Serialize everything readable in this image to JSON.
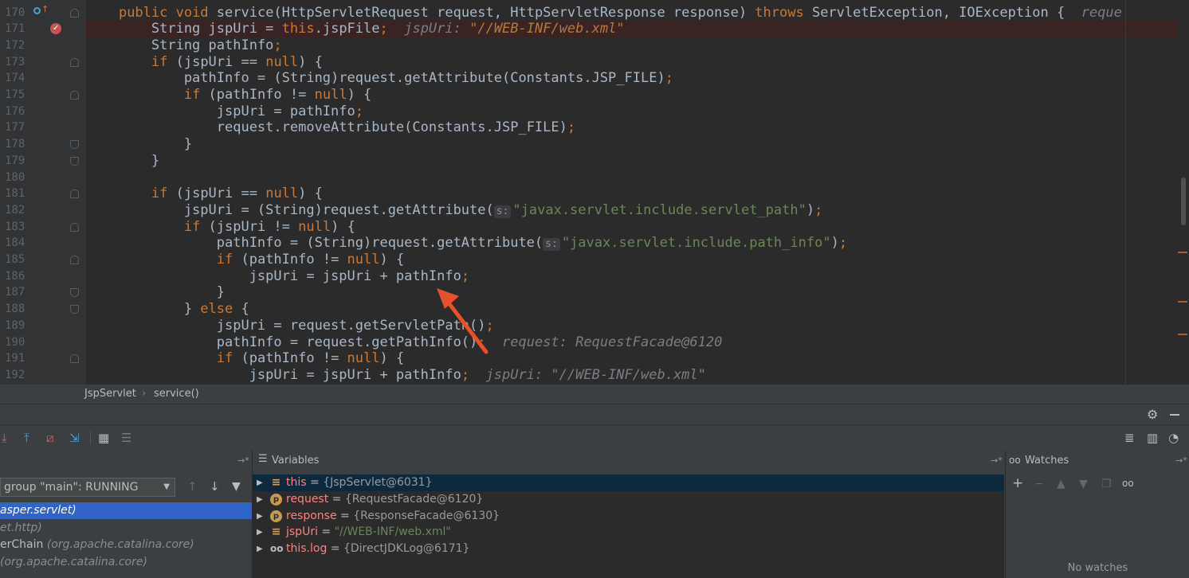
{
  "editor": {
    "lines": [
      {
        "n": "170",
        "html_key": "l170"
      },
      {
        "n": "171",
        "html_key": "l171"
      },
      {
        "n": "172",
        "html_key": "l172"
      },
      {
        "n": "173",
        "html_key": "l173"
      },
      {
        "n": "174",
        "html_key": "l174"
      },
      {
        "n": "175",
        "html_key": "l175"
      },
      {
        "n": "176",
        "html_key": "l176"
      },
      {
        "n": "177",
        "html_key": "l177"
      },
      {
        "n": "178",
        "html_key": "l178"
      },
      {
        "n": "179",
        "html_key": "l179"
      },
      {
        "n": "180",
        "html_key": "l180"
      },
      {
        "n": "181",
        "html_key": "l181"
      },
      {
        "n": "182",
        "html_key": "l182"
      },
      {
        "n": "183",
        "html_key": "l183"
      },
      {
        "n": "184",
        "html_key": "l184"
      },
      {
        "n": "185",
        "html_key": "l185"
      },
      {
        "n": "186",
        "html_key": "l186"
      },
      {
        "n": "187",
        "html_key": "l187"
      },
      {
        "n": "188",
        "html_key": "l188"
      },
      {
        "n": "189",
        "html_key": "l189"
      },
      {
        "n": "190",
        "html_key": "l190"
      },
      {
        "n": "191",
        "html_key": "l191"
      },
      {
        "n": "192",
        "html_key": "l192"
      }
    ],
    "code": {
      "l170": [
        [
          "    ",
          ""
        ],
        [
          "public void ",
          "kw"
        ],
        [
          "service(HttpServletRequest request, HttpServletResponse response) ",
          ""
        ],
        [
          "throws ",
          "kw"
        ],
        [
          "ServletException, IOException {  ",
          ""
        ],
        [
          "reque",
          "inlay"
        ]
      ],
      "l171": [
        [
          "        String ",
          ""
        ],
        [
          "jspUri = ",
          ""
        ],
        [
          "this",
          "kw"
        ],
        [
          ".jspFile",
          ""
        ],
        [
          ";",
          "kw"
        ],
        [
          "  jspUri: ",
          "inlay"
        ],
        [
          "\"//WEB-INF/web.xml\"",
          "inlay-str"
        ]
      ],
      "l172": [
        [
          "        String pathInfo",
          ""
        ],
        [
          ";",
          "kw"
        ]
      ],
      "l173": [
        [
          "        ",
          ""
        ],
        [
          "if ",
          "kw"
        ],
        [
          "(jspUri == ",
          ""
        ],
        [
          "null",
          "kw"
        ],
        [
          ") {",
          ""
        ]
      ],
      "l174": [
        [
          "            pathInfo = (String)request.getAttribute(Constants.",
          ""
        ],
        [
          "JSP_FILE",
          ""
        ],
        [
          ")",
          ""
        ],
        [
          ";",
          "kw"
        ]
      ],
      "l175": [
        [
          "            ",
          ""
        ],
        [
          "if ",
          "kw"
        ],
        [
          "(pathInfo != ",
          ""
        ],
        [
          "null",
          "kw"
        ],
        [
          ") {",
          ""
        ]
      ],
      "l176": [
        [
          "                jspUri = pathInfo",
          ""
        ],
        [
          ";",
          "kw"
        ]
      ],
      "l177": [
        [
          "                request.removeAttribute(Constants.",
          ""
        ],
        [
          "JSP_FILE",
          ""
        ],
        [
          ")",
          ""
        ],
        [
          ";",
          "kw"
        ]
      ],
      "l178": [
        [
          "            }",
          ""
        ]
      ],
      "l179": [
        [
          "        }",
          ""
        ]
      ],
      "l180": [
        [
          "",
          ""
        ]
      ],
      "l181": [
        [
          "        ",
          ""
        ],
        [
          "if ",
          "kw"
        ],
        [
          "(jspUri == ",
          ""
        ],
        [
          "null",
          "kw"
        ],
        [
          ") {",
          ""
        ]
      ],
      "l182": [
        [
          "            jspUri = (String)request.getAttribute(",
          ""
        ],
        [
          "s:",
          "hint"
        ],
        [
          "\"javax.servlet.include.servlet_path\"",
          "str"
        ],
        [
          ")",
          ""
        ],
        [
          ";",
          "kw"
        ]
      ],
      "l183": [
        [
          "            ",
          ""
        ],
        [
          "if ",
          "kw"
        ],
        [
          "(jspUri != ",
          ""
        ],
        [
          "null",
          "kw"
        ],
        [
          ") {",
          ""
        ]
      ],
      "l184": [
        [
          "                pathInfo = (String)request.getAttribute(",
          ""
        ],
        [
          "s:",
          "hint"
        ],
        [
          "\"javax.servlet.include.path_info\"",
          "str"
        ],
        [
          ")",
          ""
        ],
        [
          ";",
          "kw"
        ]
      ],
      "l185": [
        [
          "                ",
          ""
        ],
        [
          "if ",
          "kw"
        ],
        [
          "(pathInfo != ",
          ""
        ],
        [
          "null",
          "kw"
        ],
        [
          ") {",
          ""
        ]
      ],
      "l186": [
        [
          "                    jspUri = jspUri + pathInfo",
          ""
        ],
        [
          ";",
          "kw"
        ]
      ],
      "l187": [
        [
          "                }",
          ""
        ]
      ],
      "l188": [
        [
          "            } ",
          ""
        ],
        [
          "else ",
          "kw"
        ],
        [
          "{",
          ""
        ]
      ],
      "l189": [
        [
          "                jspUri = request.getServletPath()",
          ""
        ],
        [
          ";",
          "kw"
        ]
      ],
      "l190": [
        [
          "                pathInfo = request.getPathInfo()",
          ""
        ],
        [
          ";",
          "kw"
        ],
        [
          "  request: RequestFacade@6120",
          "inlay"
        ]
      ],
      "l191": [
        [
          "                ",
          ""
        ],
        [
          "if ",
          "kw"
        ],
        [
          "(pathInfo != ",
          ""
        ],
        [
          "null",
          "kw"
        ],
        [
          ") {",
          ""
        ]
      ],
      "l192": [
        [
          "                    jspUri = jspUri + pathInfo",
          ""
        ],
        [
          ";",
          "kw"
        ],
        [
          "  jspUri: ",
          "inlay"
        ],
        [
          "\"//WEB-INF/web.xml\"",
          "inlay"
        ]
      ]
    }
  },
  "breadcrumb": {
    "class_name": "JspServlet",
    "sep": "›",
    "method": "service()"
  },
  "debug": {
    "frames_pin": "→*",
    "thread_selector": "group \"main\": RUNNING",
    "frames": [
      {
        "method": "asper.servlet)",
        "pkg": "",
        "selected": true
      },
      {
        "method": "",
        "pkg": "et.http)",
        "selected": false
      },
      {
        "method": "erChain ",
        "pkg": "(org.apache.catalina.core)",
        "selected": false
      },
      {
        "method": "",
        "pkg": "(org.apache.catalina.core)",
        "selected": false
      }
    ],
    "variables_title": "Variables",
    "variables_pin": "→*",
    "variables": [
      {
        "icon": "field-icon",
        "name": "this",
        "eq": " = ",
        "value": "{JspServlet@6031}",
        "str": false,
        "selected": true
      },
      {
        "icon": "param-icon",
        "name": "request",
        "eq": " = ",
        "value": "{RequestFacade@6120}",
        "str": false,
        "selected": false
      },
      {
        "icon": "param-icon",
        "name": "response",
        "eq": " = ",
        "value": "{ResponseFacade@6130}",
        "str": false,
        "selected": false
      },
      {
        "icon": "field-icon",
        "name": "jspUri",
        "eq": " = ",
        "value": "\"//WEB-INF/web.xml\"",
        "str": true,
        "selected": false
      },
      {
        "icon": "watch-icon",
        "name": "this.log",
        "eq": " = ",
        "value": "{DirectJDKLog@6171}",
        "str": false,
        "selected": false
      }
    ],
    "watches_title": "Watches",
    "watches_pin": "→*",
    "no_watches": "No watches"
  },
  "colors": {
    "accent_selection": "#2f65ca",
    "breakpoint": "#c75450",
    "arrow": "#e8502a"
  }
}
